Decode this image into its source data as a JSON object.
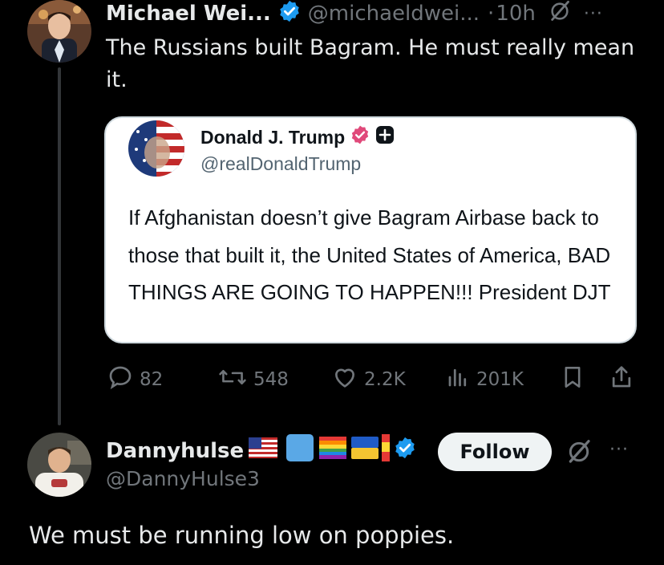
{
  "tweet1": {
    "author_name": "Michael Wei...",
    "handle": "@michaeldwei...",
    "separator": "·",
    "time": "10h",
    "more": "···",
    "text": "The Russians built Bagram. He must really mean it.",
    "quoted": {
      "author_name": "Donald J. Trump",
      "handle": "@realDonaldTrump",
      "text": "If Afghanistan doesn’t give Bagram Airbase back to those that built it, the United States of America, BAD THINGS ARE GOING TO HAPPEN!!! President DJT"
    },
    "actions": {
      "replies": "82",
      "reposts": "548",
      "likes": "2.2K",
      "views": "201K"
    }
  },
  "tweet2": {
    "author_name": "Dannyhulse",
    "handle": "@DannyHulse3",
    "follow_label": "Follow",
    "more": "···",
    "text": "We must be running low on poppies."
  },
  "colors": {
    "background": "#000000",
    "text": "#e7e9ea",
    "muted": "#71767b",
    "verified": "#1d9bf0",
    "truth_verified": "#e0497a"
  }
}
